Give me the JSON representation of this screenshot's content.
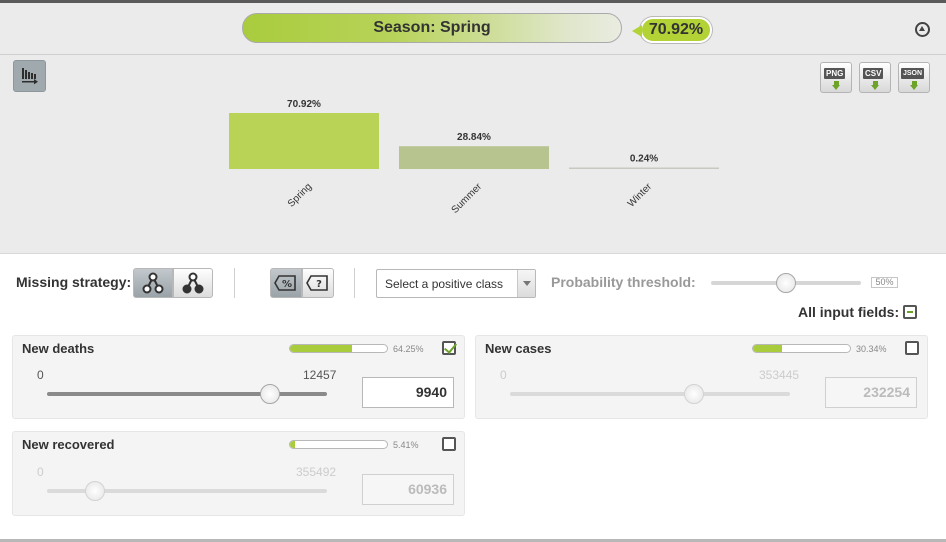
{
  "header": {
    "prediction_label": "Season: Spring",
    "confidence": "70.92%",
    "collapse_icon": "chevron-up-circle-icon"
  },
  "toolbar": {
    "chart_toggle_icon": "bar-chart-icon",
    "exports": [
      {
        "label": "PNG",
        "icon": "download-arrow-icon"
      },
      {
        "label": "CSV",
        "icon": "download-arrow-icon"
      },
      {
        "label": "JSON",
        "icon": "download-arrow-icon"
      }
    ]
  },
  "chart_data": {
    "type": "bar",
    "categories": [
      "Spring",
      "Summer",
      "Winter"
    ],
    "values": [
      70.92,
      28.84,
      0.24
    ],
    "value_labels": [
      "70.92%",
      "28.84%",
      "0.24%"
    ],
    "colors": [
      "#b9d356",
      "#b7c490",
      "#c6c9c0"
    ],
    "ylim": [
      0,
      100
    ],
    "grid": false,
    "legend": "none"
  },
  "controls": {
    "missing_strategy_label": "Missing strategy:",
    "missing_strategy_options": [
      "last-prediction-icon",
      "proportional-icon"
    ],
    "mode_options": [
      "percent-icon",
      "question-icon"
    ],
    "positive_class_placeholder": "Select a positive class",
    "probability_threshold_label": "Probability threshold:",
    "probability_threshold_value": "50%",
    "probability_threshold": 0.5,
    "all_input_fields_label": "All input fields:"
  },
  "fields": [
    {
      "name": "New deaths",
      "importance": 0.6425,
      "importance_label": "64.25%",
      "min": "0",
      "max": "12457",
      "value": "9940",
      "slider_fraction": 0.798,
      "enabled": true
    },
    {
      "name": "New cases",
      "importance": 0.3034,
      "importance_label": "30.34%",
      "min": "0",
      "max": "353445",
      "value": "232254",
      "slider_fraction": 0.657,
      "enabled": false
    },
    {
      "name": "New recovered",
      "importance": 0.0541,
      "importance_label": "5.41%",
      "min": "0",
      "max": "355492",
      "value": "60936",
      "slider_fraction": 0.171,
      "enabled": false
    }
  ]
}
